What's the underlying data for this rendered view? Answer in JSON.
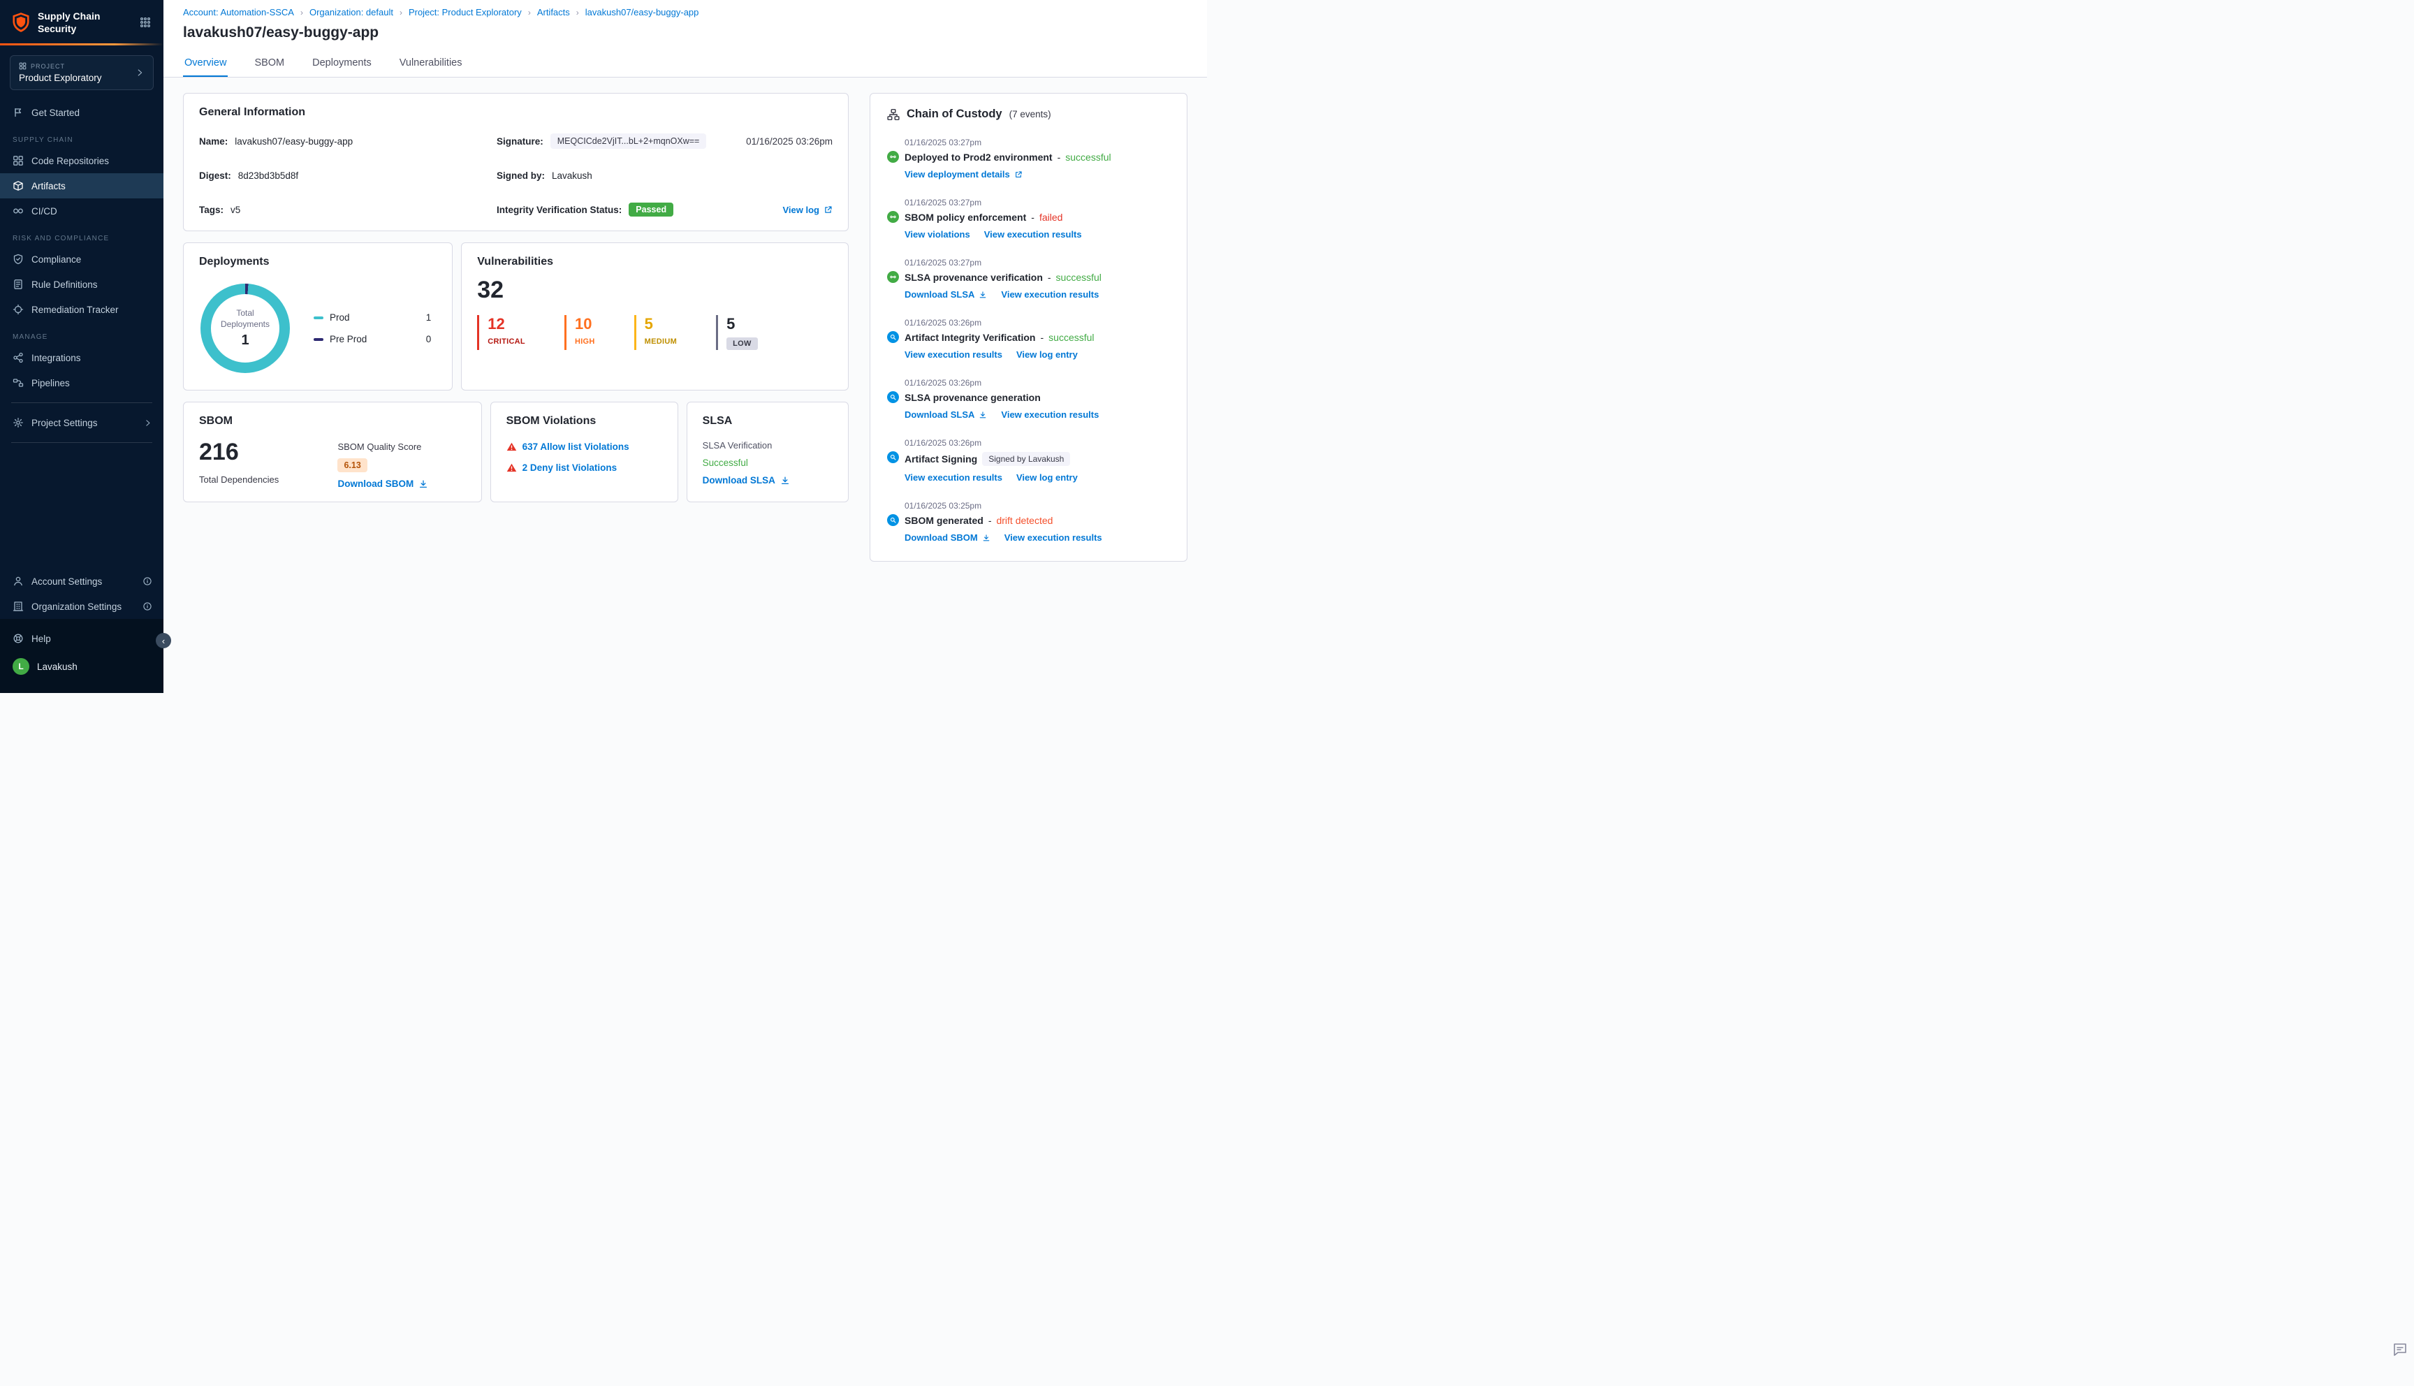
{
  "colors": {
    "accent_blue": "#0278d5",
    "success_green": "#42ab45",
    "critical_red": "#e43326",
    "high_orange": "#ff7020",
    "medium_amber": "#fcb519",
    "drift_orange": "#f4502c",
    "donut_teal": "#3dc0cc",
    "preprod_indigo": "#2e2a72",
    "sidebar_navy": "#07182e",
    "logo_orange": "#ff5310"
  },
  "sidebar": {
    "app_title": "Supply Chain Security",
    "project": {
      "label": "PROJECT",
      "name": "Product Exploratory"
    },
    "get_started": "Get Started",
    "groups": [
      {
        "heading": "SUPPLY CHAIN",
        "items": [
          {
            "label": "Code Repositories"
          },
          {
            "label": "Artifacts",
            "active": true
          },
          {
            "label": "CI/CD"
          }
        ]
      },
      {
        "heading": "RISK AND COMPLIANCE",
        "items": [
          {
            "label": "Compliance"
          },
          {
            "label": "Rule Definitions"
          },
          {
            "label": "Remediation Tracker"
          }
        ]
      },
      {
        "heading": "MANAGE",
        "items": [
          {
            "label": "Integrations"
          },
          {
            "label": "Pipelines"
          }
        ]
      }
    ],
    "project_settings": "Project Settings",
    "account_settings": "Account Settings",
    "organization_settings": "Organization Settings",
    "help": "Help",
    "user": {
      "initial": "L",
      "name": "Lavakush"
    }
  },
  "breadcrumb": {
    "items": [
      "Account: Automation-SSCA",
      "Organization: default",
      "Project: Product Exploratory",
      "Artifacts",
      "lavakush07/easy-buggy-app"
    ]
  },
  "header": {
    "title": "lavakush07/easy-buggy-app"
  },
  "tabs": [
    {
      "label": "Overview",
      "active": true
    },
    {
      "label": "SBOM"
    },
    {
      "label": "Deployments"
    },
    {
      "label": "Vulnerabilities"
    }
  ],
  "general_info": {
    "title": "General Information",
    "name_label": "Name:",
    "name_value": "lavakush07/easy-buggy-app",
    "digest_label": "Digest:",
    "digest_value": "8d23bd3b5d8f",
    "tags_label": "Tags:",
    "tags_value": "v5",
    "signature_label": "Signature:",
    "signature_value": "MEQCICde2VjIT...bL+2+mqnOXw==",
    "signature_time": "01/16/2025 03:26pm",
    "signed_by_label": "Signed by:",
    "signed_by_value": "Lavakush",
    "integrity_label": "Integrity Verification Status:",
    "integrity_status": "Passed",
    "view_log": "View log"
  },
  "deployments": {
    "title": "Deployments",
    "donut_center_label": "Total Deployments",
    "donut_center_value": "1",
    "legend": [
      {
        "label": "Prod",
        "value": "1"
      },
      {
        "label": "Pre Prod",
        "value": "0"
      }
    ]
  },
  "vulnerabilities": {
    "title": "Vulnerabilities",
    "total": "32",
    "severities": [
      {
        "count": "12",
        "label": "CRITICAL"
      },
      {
        "count": "10",
        "label": "HIGH"
      },
      {
        "count": "5",
        "label": "MEDIUM"
      },
      {
        "count": "5",
        "label": "LOW"
      }
    ]
  },
  "sbom": {
    "title": "SBOM",
    "total": "216",
    "total_label": "Total Dependencies",
    "quality_label": "SBOM Quality Score",
    "quality_score": "6.13",
    "download": "Download SBOM"
  },
  "sbom_violations": {
    "title": "SBOM Violations",
    "items": [
      "637 Allow list Violations",
      "2 Deny list Violations"
    ]
  },
  "slsa": {
    "title": "SLSA",
    "verification_label": "SLSA Verification",
    "status": "Successful",
    "download": "Download SLSA"
  },
  "chain_of_custody": {
    "title": "Chain of Custody",
    "events_count": "(7 events)",
    "events": [
      {
        "time": "01/16/2025 03:27pm",
        "title": "Deployed to Prod2 environment",
        "status": "successful",
        "links": [
          "View deployment details"
        ]
      },
      {
        "time": "01/16/2025 03:27pm",
        "title": "SBOM policy enforcement",
        "status": "failed",
        "links": [
          "View violations",
          "View execution results"
        ]
      },
      {
        "time": "01/16/2025 03:27pm",
        "title": "SLSA provenance verification",
        "status": "successful",
        "links": [
          "Download SLSA",
          "View execution results"
        ]
      },
      {
        "time": "01/16/2025 03:26pm",
        "title": "Artifact Integrity Verification",
        "status": "successful",
        "links": [
          "View execution results",
          "View log entry"
        ]
      },
      {
        "time": "01/16/2025 03:26pm",
        "title": "SLSA provenance generation",
        "links": [
          "Download SLSA",
          "View execution results"
        ]
      },
      {
        "time": "01/16/2025 03:26pm",
        "title": "Artifact Signing",
        "badge": "Signed by Lavakush",
        "links": [
          "View execution results",
          "View log entry"
        ]
      },
      {
        "time": "01/16/2025 03:25pm",
        "title": "SBOM generated",
        "status": "drift detected",
        "links": [
          "Download SBOM",
          "View execution results"
        ]
      }
    ]
  }
}
